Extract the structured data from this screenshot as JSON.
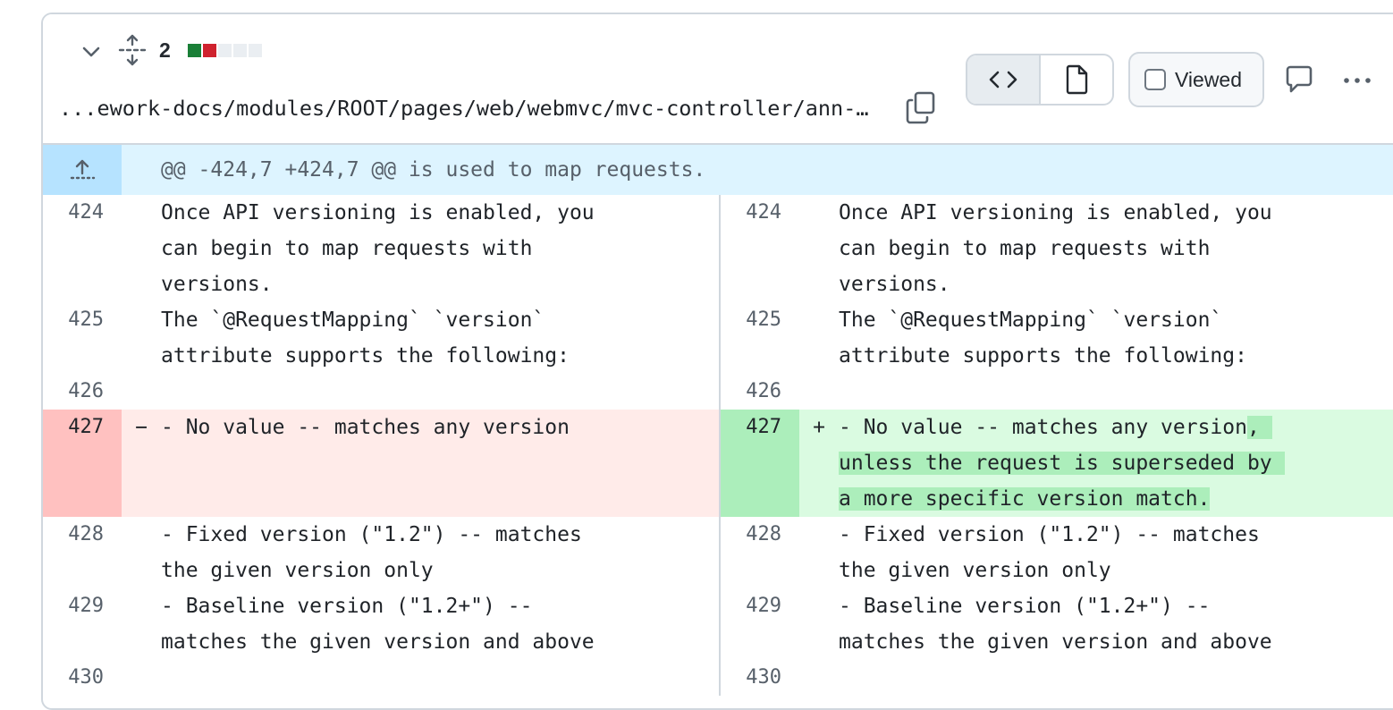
{
  "header": {
    "file_count": "2",
    "diffstat": [
      "#1a7f37",
      "#cf222e",
      "#eaeef2",
      "#eaeef2",
      "#eaeef2"
    ],
    "path": "...ework-docs/modules/ROOT/pages/web/webmvc/mvc-controller/ann-…",
    "viewed_label": "Viewed",
    "icons": {
      "collapse": "chevron-down-icon",
      "expand": "fold-icon",
      "copy": "copy-icon",
      "code_view": "code-icon",
      "file_view": "file-icon",
      "comment": "comment-icon",
      "more": "kebab-horizontal-icon"
    }
  },
  "hunk": {
    "header": "@@ -424,7 +424,7 @@ is used to map requests."
  },
  "rows": [
    {
      "left_num": "424",
      "left_lines": [
        "Once API versioning is enabled, you",
        "can begin to map requests with",
        "versions."
      ],
      "right_num": "424",
      "right_lines": [
        "Once API versioning is enabled, you",
        "can begin to map requests with",
        "versions."
      ]
    },
    {
      "left_num": "425",
      "left_lines": [
        "The `@RequestMapping` `version`",
        "attribute supports the following:"
      ],
      "right_num": "425",
      "right_lines": [
        "The `@RequestMapping` `version`",
        "attribute supports the following:"
      ]
    },
    {
      "left_num": "426",
      "left_lines": [
        ""
      ],
      "right_num": "426",
      "right_lines": [
        ""
      ]
    },
    {
      "left_num": "427",
      "left_sign": "−",
      "left_lines": [
        "- No value -- matches any version"
      ],
      "right_num": "427",
      "right_sign": "+",
      "right_lines": [
        "- No value -- matches any version",
        "unless the request is superseded by ",
        "a more specific version match."
      ],
      "right_hl": [
        ", ",
        "unless the request is superseded by ",
        "a more specific version match."
      ],
      "changed": true
    },
    {
      "left_num": "428",
      "left_lines": [
        "- Fixed version (\"1.2\") -- matches",
        "the given version only"
      ],
      "right_num": "428",
      "right_lines": [
        "- Fixed version (\"1.2\") -- matches",
        "the given version only"
      ]
    },
    {
      "left_num": "429",
      "left_lines": [
        "- Baseline version (\"1.2+\") --",
        "matches the given version and above"
      ],
      "right_num": "429",
      "right_lines": [
        "- Baseline version (\"1.2+\") --",
        "matches the given version and above"
      ]
    },
    {
      "left_num": "430",
      "left_lines": [
        ""
      ],
      "right_num": "430",
      "right_lines": [
        ""
      ]
    }
  ]
}
